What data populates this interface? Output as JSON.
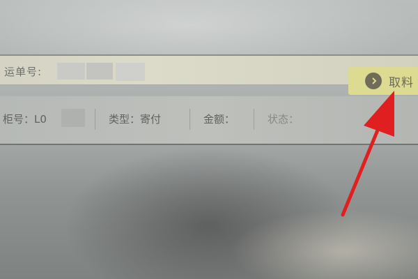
{
  "waybill": {
    "label": "运单号:"
  },
  "pickup_button": {
    "label": "取料",
    "icon": "arrow-right-circle-icon"
  },
  "info_row": {
    "cabinet_label": "柜号：L0",
    "type_label": "类型：寄付",
    "amount_label": "金额：",
    "status_label": "状态："
  },
  "colors": {
    "button_bg": "#dcdb91",
    "annotation_arrow": "#e02020"
  }
}
